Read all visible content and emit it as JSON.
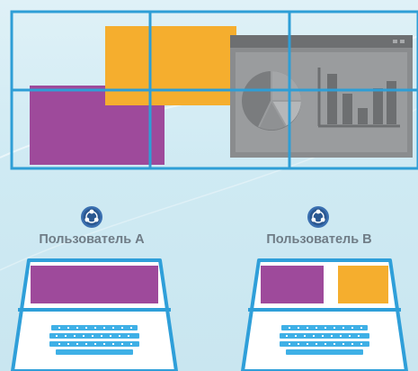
{
  "colors": {
    "grid_line": "#2e9ed6",
    "purple": "#9e4a9b",
    "orange": "#f5ae2e",
    "window_gray": "#8a8c8e",
    "laptop_blue": "#2f9fd9",
    "keyboard_blue": "#3fb0e6",
    "label_gray": "#6f7c86"
  },
  "users": [
    {
      "label": "Пользователь A",
      "screen": [
        "purple"
      ]
    },
    {
      "label": "Пользователь B",
      "screen": [
        "purple",
        "orange"
      ]
    }
  ],
  "icons": [
    "users-network-icon",
    "chart-window-icon",
    "keyboard-icon"
  ]
}
